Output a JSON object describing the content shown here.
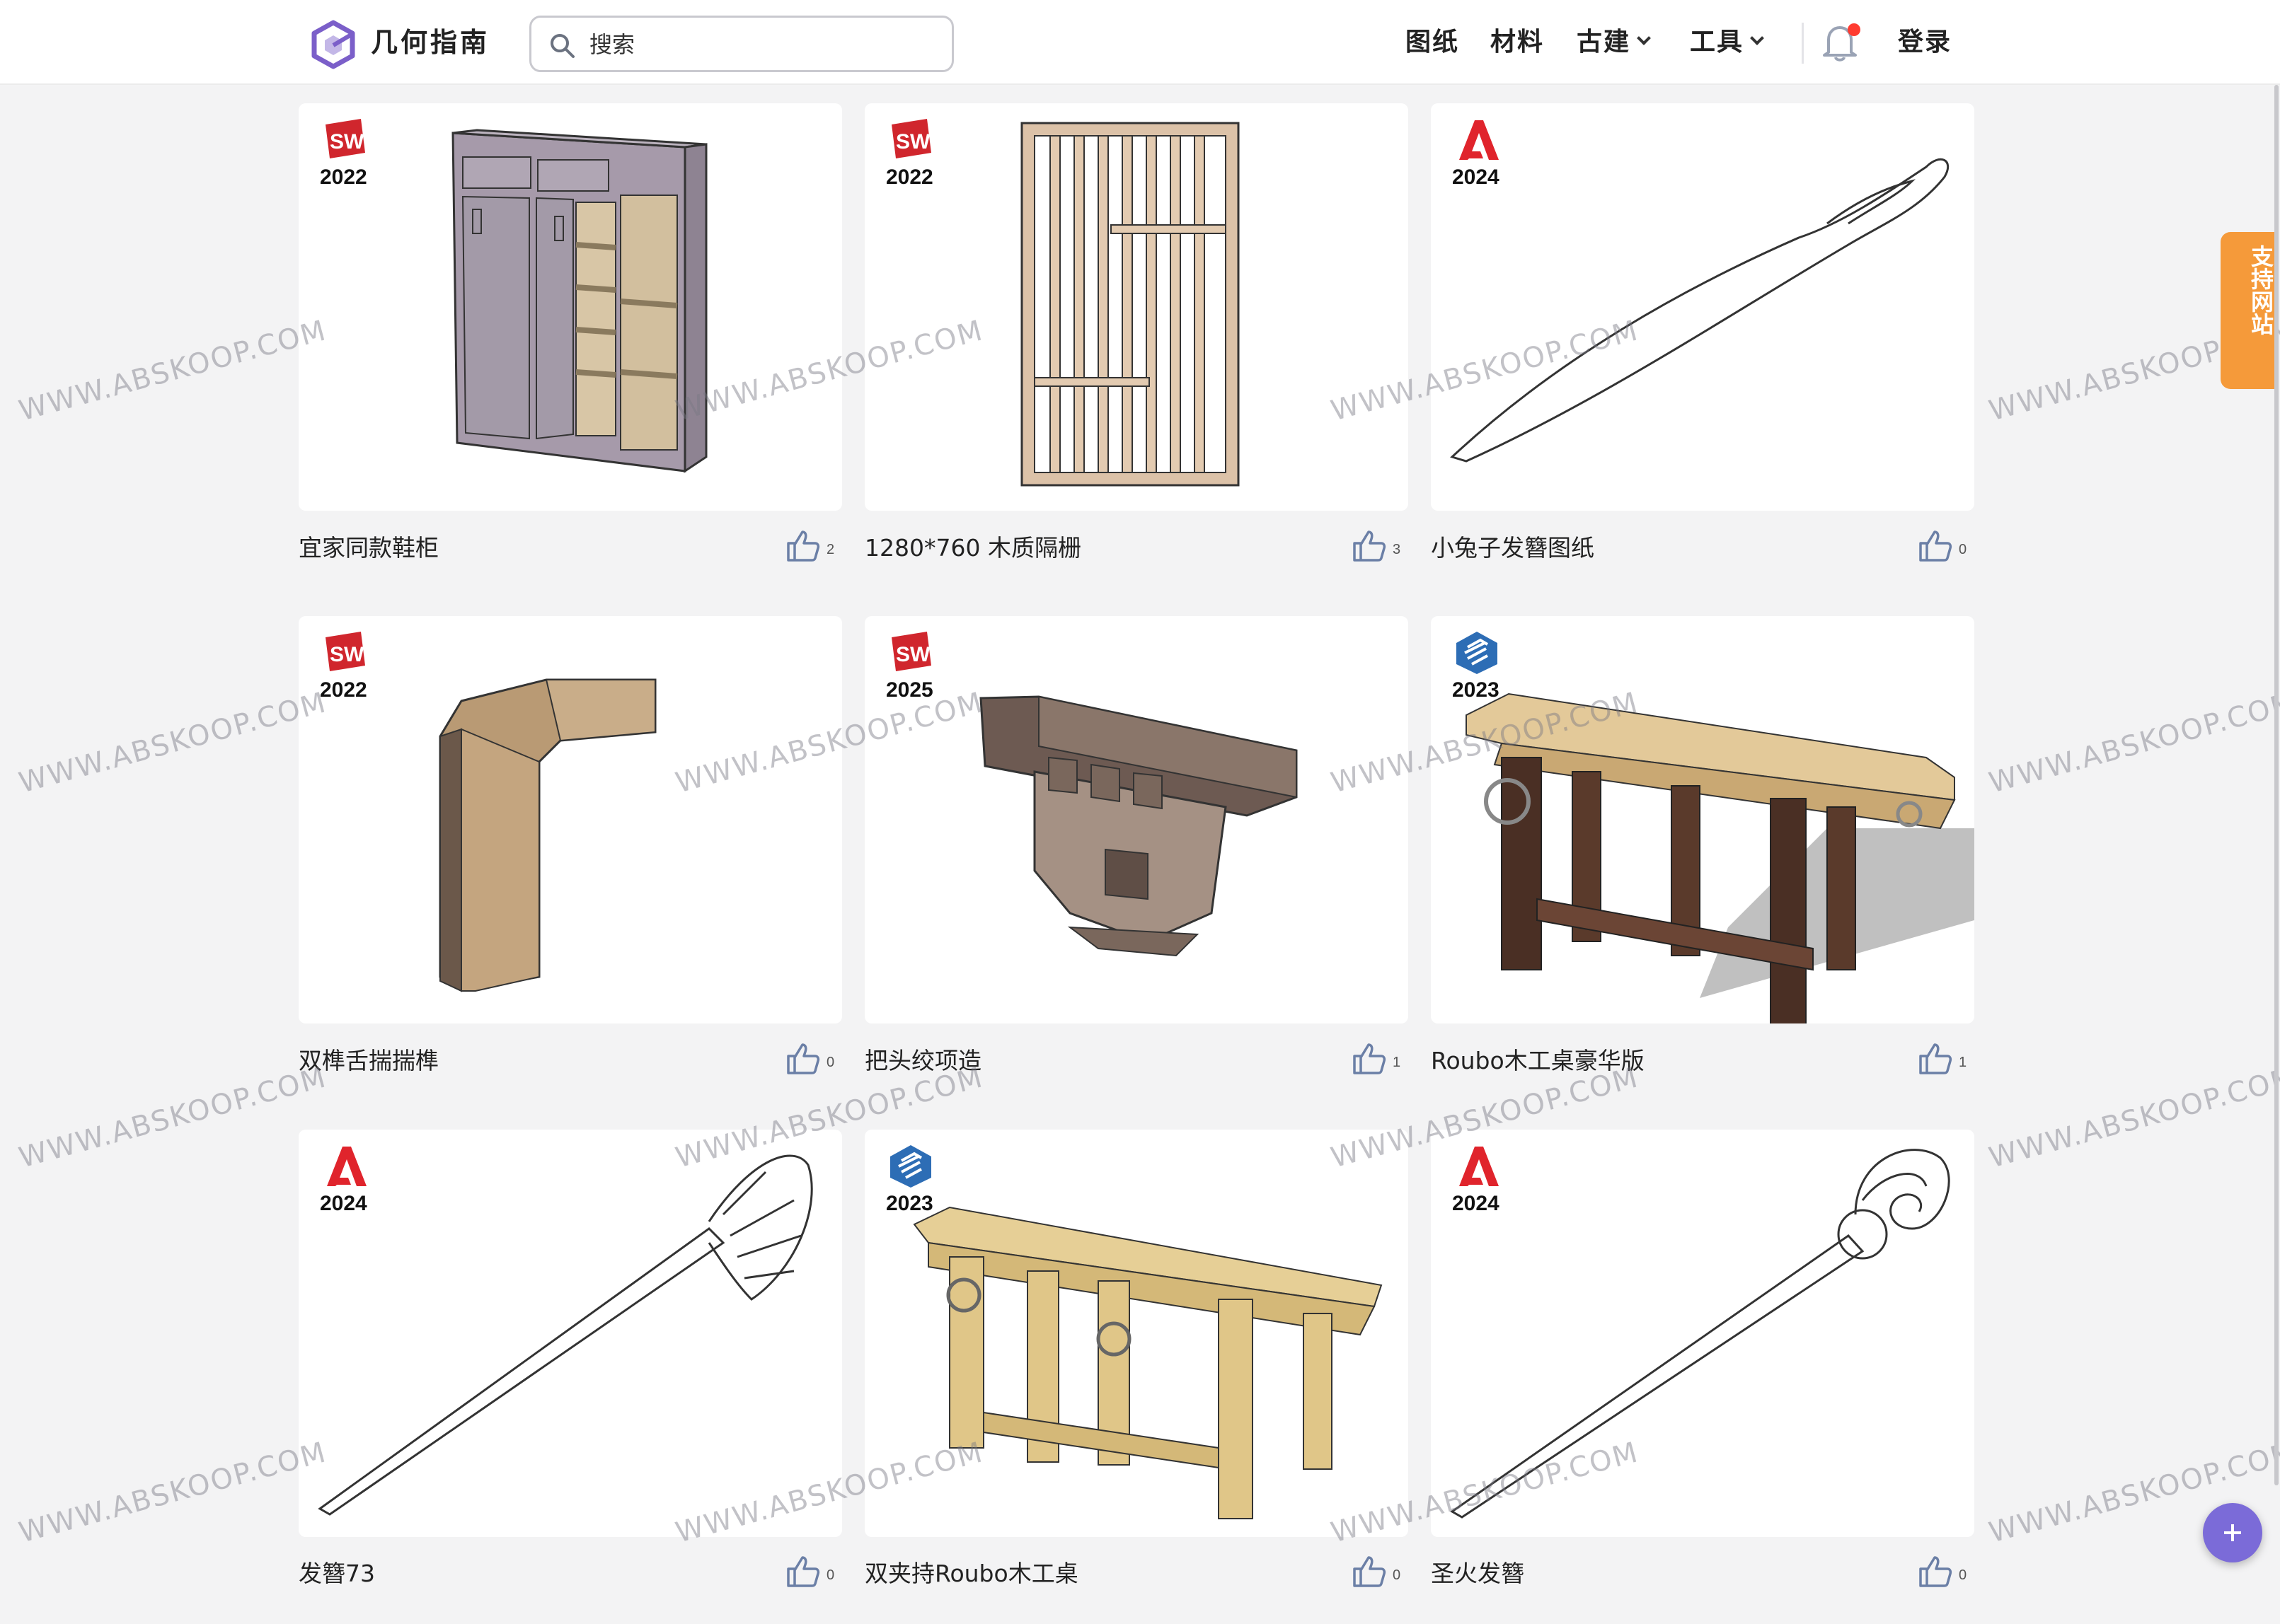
{
  "header": {
    "brand": "几何指南",
    "search_placeholder": "搜索",
    "nav": [
      {
        "label": "图纸"
      },
      {
        "label": "材料"
      },
      {
        "label": "古建"
      },
      {
        "label": "工具"
      }
    ],
    "login_label": "登录",
    "notification_dot_color": "#ff3b30",
    "logo_color": "#7b5fc9"
  },
  "cards": [
    {
      "title": "宜家同款鞋柜",
      "software": "SOLIDWORKS",
      "icon": "solidworks-icon",
      "year": "2022",
      "likes": "2"
    },
    {
      "title": "1280*760 木质隔栅",
      "software": "SOLIDWORKS",
      "icon": "solidworks-icon",
      "year": "2022",
      "likes": "3"
    },
    {
      "title": "小兔子发簪图纸",
      "software": "AutoCAD",
      "icon": "autocad-icon",
      "year": "2024",
      "likes": "0"
    },
    {
      "title": "双榫舌揣揣榫",
      "software": "SOLIDWORKS",
      "icon": "solidworks-icon",
      "year": "2022",
      "likes": "0"
    },
    {
      "title": "把头绞项造",
      "software": "SOLIDWORKS",
      "icon": "solidworks-icon",
      "year": "2025",
      "likes": "1"
    },
    {
      "title": "Roubo木工桌豪华版",
      "software": "SketchUp",
      "icon": "sketchup-icon",
      "year": "2023",
      "likes": "1"
    },
    {
      "title": "发簪73",
      "software": "AutoCAD",
      "icon": "autocad-icon",
      "year": "2024",
      "likes": "0"
    },
    {
      "title": "双夹持Roubo木工桌",
      "software": "SketchUp",
      "icon": "sketchup-icon",
      "year": "2023",
      "likes": "0"
    },
    {
      "title": "圣火发簪",
      "software": "AutoCAD",
      "icon": "autocad-icon",
      "year": "2024",
      "likes": "0"
    }
  ],
  "support_label": "支持网站",
  "watermark_text": "WWW.ABSKOOP.COM",
  "colors": {
    "accent": "#7b6bd8",
    "support": "#f59a3a",
    "solidworks": "#d0262d",
    "autocad": "#e0242c",
    "sketchup": "#2d6db5"
  }
}
